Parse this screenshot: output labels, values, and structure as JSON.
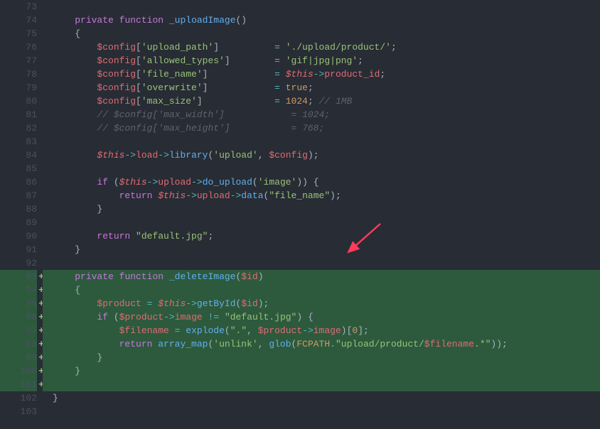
{
  "startLine": 73,
  "lines": [
    {
      "num": 73,
      "added": false,
      "hl": false,
      "tokens": [
        {
          "t": "plain",
          "v": ""
        }
      ]
    },
    {
      "num": 74,
      "added": false,
      "hl": false,
      "tokens": [
        {
          "t": "plain",
          "v": "    "
        },
        {
          "t": "keyword",
          "v": "private"
        },
        {
          "t": "plain",
          "v": " "
        },
        {
          "t": "keyword",
          "v": "function"
        },
        {
          "t": "plain",
          "v": " "
        },
        {
          "t": "function-name",
          "v": "_uploadImage"
        },
        {
          "t": "punctuation",
          "v": "()"
        }
      ]
    },
    {
      "num": 75,
      "added": false,
      "hl": false,
      "tokens": [
        {
          "t": "plain",
          "v": "    "
        },
        {
          "t": "bracket",
          "v": "{"
        }
      ]
    },
    {
      "num": 76,
      "added": false,
      "hl": false,
      "tokens": [
        {
          "t": "plain",
          "v": "        "
        },
        {
          "t": "variable",
          "v": "$config"
        },
        {
          "t": "punctuation",
          "v": "["
        },
        {
          "t": "string",
          "v": "'upload_path'"
        },
        {
          "t": "punctuation",
          "v": "]"
        },
        {
          "t": "plain",
          "v": "          "
        },
        {
          "t": "operator",
          "v": "="
        },
        {
          "t": "plain",
          "v": " "
        },
        {
          "t": "string",
          "v": "'./upload/product/'"
        },
        {
          "t": "punctuation",
          "v": ";"
        }
      ]
    },
    {
      "num": 77,
      "added": false,
      "hl": false,
      "tokens": [
        {
          "t": "plain",
          "v": "        "
        },
        {
          "t": "variable",
          "v": "$config"
        },
        {
          "t": "punctuation",
          "v": "["
        },
        {
          "t": "string",
          "v": "'allowed_types'"
        },
        {
          "t": "punctuation",
          "v": "]"
        },
        {
          "t": "plain",
          "v": "        "
        },
        {
          "t": "operator",
          "v": "="
        },
        {
          "t": "plain",
          "v": " "
        },
        {
          "t": "string",
          "v": "'gif|jpg|png'"
        },
        {
          "t": "punctuation",
          "v": ";"
        }
      ]
    },
    {
      "num": 78,
      "added": false,
      "hl": false,
      "tokens": [
        {
          "t": "plain",
          "v": "        "
        },
        {
          "t": "variable",
          "v": "$config"
        },
        {
          "t": "punctuation",
          "v": "["
        },
        {
          "t": "string",
          "v": "'file_name'"
        },
        {
          "t": "punctuation",
          "v": "]"
        },
        {
          "t": "plain",
          "v": "            "
        },
        {
          "t": "operator",
          "v": "="
        },
        {
          "t": "plain",
          "v": " "
        },
        {
          "t": "this",
          "v": "$this"
        },
        {
          "t": "operator",
          "v": "->"
        },
        {
          "t": "property",
          "v": "product_id"
        },
        {
          "t": "punctuation",
          "v": ";"
        }
      ]
    },
    {
      "num": 79,
      "added": false,
      "hl": false,
      "tokens": [
        {
          "t": "plain",
          "v": "        "
        },
        {
          "t": "variable",
          "v": "$config"
        },
        {
          "t": "punctuation",
          "v": "["
        },
        {
          "t": "string",
          "v": "'overwrite'"
        },
        {
          "t": "punctuation",
          "v": "]"
        },
        {
          "t": "plain",
          "v": "            "
        },
        {
          "t": "operator",
          "v": "="
        },
        {
          "t": "plain",
          "v": " "
        },
        {
          "t": "boolean",
          "v": "true"
        },
        {
          "t": "punctuation",
          "v": ";"
        }
      ]
    },
    {
      "num": 80,
      "added": false,
      "hl": false,
      "tokens": [
        {
          "t": "plain",
          "v": "        "
        },
        {
          "t": "variable",
          "v": "$config"
        },
        {
          "t": "punctuation",
          "v": "["
        },
        {
          "t": "string",
          "v": "'max_size'"
        },
        {
          "t": "punctuation",
          "v": "]"
        },
        {
          "t": "plain",
          "v": "             "
        },
        {
          "t": "operator",
          "v": "="
        },
        {
          "t": "plain",
          "v": " "
        },
        {
          "t": "number",
          "v": "1024"
        },
        {
          "t": "punctuation",
          "v": ";"
        },
        {
          "t": "plain",
          "v": " "
        },
        {
          "t": "comment",
          "v": "// 1MB"
        }
      ]
    },
    {
      "num": 81,
      "added": false,
      "hl": false,
      "tokens": [
        {
          "t": "plain",
          "v": "        "
        },
        {
          "t": "comment",
          "v": "// $config['max_width']            = 1024;"
        }
      ]
    },
    {
      "num": 82,
      "added": false,
      "hl": false,
      "tokens": [
        {
          "t": "plain",
          "v": "        "
        },
        {
          "t": "comment",
          "v": "// $config['max_height']           = 768;"
        }
      ]
    },
    {
      "num": 83,
      "added": false,
      "hl": false,
      "tokens": [
        {
          "t": "plain",
          "v": ""
        }
      ]
    },
    {
      "num": 84,
      "added": false,
      "hl": false,
      "tokens": [
        {
          "t": "plain",
          "v": "        "
        },
        {
          "t": "this",
          "v": "$this"
        },
        {
          "t": "operator",
          "v": "->"
        },
        {
          "t": "property",
          "v": "load"
        },
        {
          "t": "operator",
          "v": "->"
        },
        {
          "t": "function-call",
          "v": "library"
        },
        {
          "t": "punctuation",
          "v": "("
        },
        {
          "t": "string",
          "v": "'upload'"
        },
        {
          "t": "punctuation",
          "v": ", "
        },
        {
          "t": "variable",
          "v": "$config"
        },
        {
          "t": "punctuation",
          "v": ");"
        }
      ]
    },
    {
      "num": 85,
      "added": false,
      "hl": false,
      "tokens": [
        {
          "t": "plain",
          "v": ""
        }
      ]
    },
    {
      "num": 86,
      "added": false,
      "hl": false,
      "tokens": [
        {
          "t": "plain",
          "v": "        "
        },
        {
          "t": "keyword",
          "v": "if"
        },
        {
          "t": "plain",
          "v": " "
        },
        {
          "t": "punctuation",
          "v": "("
        },
        {
          "t": "this",
          "v": "$this"
        },
        {
          "t": "operator",
          "v": "->"
        },
        {
          "t": "property",
          "v": "upload"
        },
        {
          "t": "operator",
          "v": "->"
        },
        {
          "t": "function-call",
          "v": "do_upload"
        },
        {
          "t": "punctuation",
          "v": "("
        },
        {
          "t": "string",
          "v": "'image'"
        },
        {
          "t": "punctuation",
          "v": ")) {"
        }
      ]
    },
    {
      "num": 87,
      "added": false,
      "hl": false,
      "tokens": [
        {
          "t": "plain",
          "v": "            "
        },
        {
          "t": "keyword",
          "v": "return"
        },
        {
          "t": "plain",
          "v": " "
        },
        {
          "t": "this",
          "v": "$this"
        },
        {
          "t": "operator",
          "v": "->"
        },
        {
          "t": "property",
          "v": "upload"
        },
        {
          "t": "operator",
          "v": "->"
        },
        {
          "t": "function-call",
          "v": "data"
        },
        {
          "t": "punctuation",
          "v": "("
        },
        {
          "t": "string",
          "v": "\"file_name\""
        },
        {
          "t": "punctuation",
          "v": ");"
        }
      ]
    },
    {
      "num": 88,
      "added": false,
      "hl": false,
      "tokens": [
        {
          "t": "plain",
          "v": "        "
        },
        {
          "t": "bracket",
          "v": "}"
        }
      ]
    },
    {
      "num": 89,
      "added": false,
      "hl": false,
      "tokens": [
        {
          "t": "plain",
          "v": ""
        }
      ]
    },
    {
      "num": 90,
      "added": false,
      "hl": false,
      "tokens": [
        {
          "t": "plain",
          "v": "        "
        },
        {
          "t": "keyword",
          "v": "return"
        },
        {
          "t": "plain",
          "v": " "
        },
        {
          "t": "string",
          "v": "\"default.jpg\""
        },
        {
          "t": "punctuation",
          "v": ";"
        }
      ]
    },
    {
      "num": 91,
      "added": false,
      "hl": false,
      "tokens": [
        {
          "t": "plain",
          "v": "    "
        },
        {
          "t": "bracket",
          "v": "}"
        }
      ]
    },
    {
      "num": 92,
      "added": false,
      "hl": false,
      "tokens": [
        {
          "t": "plain",
          "v": ""
        }
      ]
    },
    {
      "num": 93,
      "added": true,
      "hl": true,
      "tokens": [
        {
          "t": "plain",
          "v": "    "
        },
        {
          "t": "keyword",
          "v": "private"
        },
        {
          "t": "plain",
          "v": " "
        },
        {
          "t": "keyword",
          "v": "function"
        },
        {
          "t": "plain",
          "v": " "
        },
        {
          "t": "function-name",
          "v": "_deleteImage"
        },
        {
          "t": "punctuation",
          "v": "("
        },
        {
          "t": "variable",
          "v": "$id"
        },
        {
          "t": "punctuation",
          "v": ")"
        }
      ]
    },
    {
      "num": 94,
      "added": true,
      "hl": true,
      "tokens": [
        {
          "t": "plain",
          "v": "    "
        },
        {
          "t": "bracket",
          "v": "{"
        }
      ]
    },
    {
      "num": 95,
      "added": true,
      "hl": true,
      "tokens": [
        {
          "t": "plain",
          "v": "        "
        },
        {
          "t": "variable",
          "v": "$product"
        },
        {
          "t": "plain",
          "v": " "
        },
        {
          "t": "operator",
          "v": "="
        },
        {
          "t": "plain",
          "v": " "
        },
        {
          "t": "this",
          "v": "$this"
        },
        {
          "t": "operator",
          "v": "->"
        },
        {
          "t": "function-call",
          "v": "getById"
        },
        {
          "t": "punctuation",
          "v": "("
        },
        {
          "t": "variable",
          "v": "$id"
        },
        {
          "t": "punctuation",
          "v": ");"
        }
      ]
    },
    {
      "num": 96,
      "added": true,
      "hl": true,
      "tokens": [
        {
          "t": "plain",
          "v": "        "
        },
        {
          "t": "keyword",
          "v": "if"
        },
        {
          "t": "plain",
          "v": " "
        },
        {
          "t": "punctuation",
          "v": "("
        },
        {
          "t": "variable",
          "v": "$product"
        },
        {
          "t": "operator",
          "v": "->"
        },
        {
          "t": "property",
          "v": "image"
        },
        {
          "t": "plain",
          "v": " "
        },
        {
          "t": "operator",
          "v": "!="
        },
        {
          "t": "plain",
          "v": " "
        },
        {
          "t": "string",
          "v": "\"default.jpg\""
        },
        {
          "t": "punctuation",
          "v": ") {"
        }
      ]
    },
    {
      "num": 97,
      "added": true,
      "hl": true,
      "tokens": [
        {
          "t": "plain",
          "v": "            "
        },
        {
          "t": "variable",
          "v": "$filename"
        },
        {
          "t": "plain",
          "v": " "
        },
        {
          "t": "operator",
          "v": "="
        },
        {
          "t": "plain",
          "v": " "
        },
        {
          "t": "function-call",
          "v": "explode"
        },
        {
          "t": "punctuation",
          "v": "("
        },
        {
          "t": "string",
          "v": "\".\""
        },
        {
          "t": "punctuation",
          "v": ", "
        },
        {
          "t": "variable",
          "v": "$product"
        },
        {
          "t": "operator",
          "v": "->"
        },
        {
          "t": "property",
          "v": "image"
        },
        {
          "t": "punctuation",
          "v": ")["
        },
        {
          "t": "number",
          "v": "0"
        },
        {
          "t": "punctuation",
          "v": "];"
        }
      ]
    },
    {
      "num": 98,
      "added": true,
      "hl": true,
      "tokens": [
        {
          "t": "plain",
          "v": "            "
        },
        {
          "t": "keyword",
          "v": "return"
        },
        {
          "t": "plain",
          "v": " "
        },
        {
          "t": "function-call",
          "v": "array_map"
        },
        {
          "t": "punctuation",
          "v": "("
        },
        {
          "t": "string",
          "v": "'unlink'"
        },
        {
          "t": "punctuation",
          "v": ", "
        },
        {
          "t": "function-call",
          "v": "glob"
        },
        {
          "t": "punctuation",
          "v": "("
        },
        {
          "t": "constant",
          "v": "FCPATH"
        },
        {
          "t": "operator",
          "v": "."
        },
        {
          "t": "string",
          "v": "\"upload/product/"
        },
        {
          "t": "variable",
          "v": "$filename"
        },
        {
          "t": "string",
          "v": ".*\""
        },
        {
          "t": "punctuation",
          "v": "));"
        }
      ]
    },
    {
      "num": 99,
      "added": true,
      "hl": true,
      "tokens": [
        {
          "t": "plain",
          "v": "        "
        },
        {
          "t": "bracket",
          "v": "}"
        }
      ]
    },
    {
      "num": 100,
      "added": true,
      "hl": true,
      "tokens": [
        {
          "t": "plain",
          "v": "    "
        },
        {
          "t": "bracket",
          "v": "}"
        }
      ]
    },
    {
      "num": 101,
      "added": true,
      "hl": true,
      "tokens": [
        {
          "t": "plain",
          "v": ""
        }
      ]
    },
    {
      "num": 102,
      "added": false,
      "hl": false,
      "tokens": [
        {
          "t": "bracket",
          "v": "}"
        }
      ]
    },
    {
      "num": 103,
      "added": false,
      "hl": false,
      "tokens": [
        {
          "t": "plain",
          "v": ""
        }
      ]
    }
  ],
  "arrow_color": "#ff3b5b"
}
